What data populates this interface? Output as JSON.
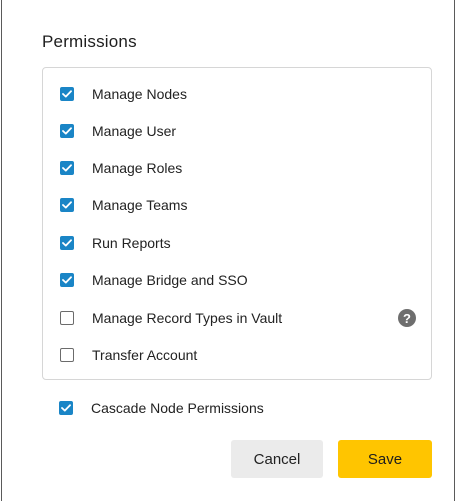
{
  "dialog": {
    "title": "Permissions"
  },
  "permissions": [
    {
      "label": "Manage Nodes",
      "checked": true
    },
    {
      "label": "Manage User",
      "checked": true
    },
    {
      "label": "Manage Roles",
      "checked": true
    },
    {
      "label": "Manage Teams",
      "checked": true
    },
    {
      "label": "Run Reports",
      "checked": true
    },
    {
      "label": "Manage Bridge and SSO",
      "checked": true
    },
    {
      "label": "Manage Record Types in Vault",
      "checked": false,
      "help_icon": "question-circle-icon",
      "help_glyph": "?"
    },
    {
      "label": "Transfer Account",
      "checked": false
    }
  ],
  "cascade": {
    "label": "Cascade Node Permissions",
    "checked": true
  },
  "buttons": {
    "cancel_label": "Cancel",
    "save_label": "Save"
  },
  "colors": {
    "checkbox_checked": "#1a85c6",
    "save_button": "#ffc500",
    "cancel_button": "#ebebeb"
  }
}
